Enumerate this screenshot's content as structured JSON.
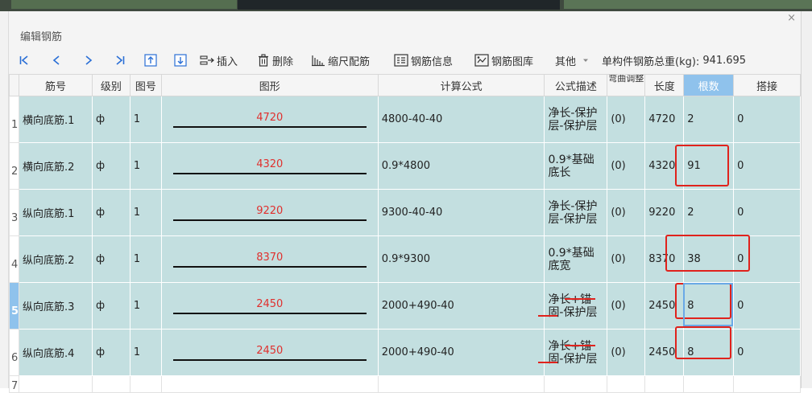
{
  "dialog": {
    "title": "编辑钢筋",
    "close_glyph": "×"
  },
  "toolbar": {
    "items": [
      {
        "icon": "first-record-icon"
      },
      {
        "icon": "prev-record-icon"
      },
      {
        "icon": "next-record-icon"
      },
      {
        "icon": "last-record-icon"
      },
      {
        "icon": "move-up-icon"
      },
      {
        "icon": "move-down-icon"
      },
      {
        "icon": "insert-icon",
        "label": "插入"
      },
      {
        "icon": "trash-icon",
        "label": "删除"
      },
      {
        "icon": "scale-rebar-icon",
        "label": "缩尺配筋"
      },
      {
        "icon": "rebar-info-icon",
        "label": "钢筋信息"
      },
      {
        "icon": "rebar-library-icon",
        "label": "钢筋图库"
      },
      {
        "icon": "chevron-down-icon",
        "label": "其他"
      }
    ],
    "total_label": "单构件钢筋总重(kg):",
    "total_value": "941.695"
  },
  "table": {
    "headers": [
      "筋号",
      "级别",
      "图号",
      "图形",
      "计算公式",
      "公式描述",
      "弯曲调整",
      "长度",
      "根数",
      "搭接"
    ],
    "selected_header": "根数",
    "rows": [
      {
        "num": "1",
        "name": "横向底筋.1",
        "grade": "ф",
        "fig": "1",
        "shape": "4720",
        "formula": "4800-40-40",
        "desc": "净长-保护层-保护层",
        "bend": "(0)",
        "length": "4720",
        "count": "2",
        "lap": "0"
      },
      {
        "num": "2",
        "name": "横向底筋.2",
        "grade": "ф",
        "fig": "1",
        "shape": "4320",
        "formula": "0.9*4800",
        "desc": "0.9*基础底长",
        "bend": "(0)",
        "length": "4320",
        "count": "91",
        "lap": "0"
      },
      {
        "num": "3",
        "name": "纵向底筋.1",
        "grade": "ф",
        "fig": "1",
        "shape": "9220",
        "formula": "9300-40-40",
        "desc": "净长-保护层-保护层",
        "bend": "(0)",
        "length": "9220",
        "count": "2",
        "lap": "0"
      },
      {
        "num": "4",
        "name": "纵向底筋.2",
        "grade": "ф",
        "fig": "1",
        "shape": "8370",
        "formula": "0.9*9300",
        "desc": "0.9*基础底宽",
        "bend": "(0)",
        "length": "8370",
        "count": "38",
        "lap": "0"
      },
      {
        "num": "5",
        "name": "纵向底筋.3",
        "grade": "ф",
        "fig": "1",
        "shape": "2450",
        "formula": "2000+490-40",
        "desc": "净长+锚固-保护层",
        "bend": "(0)",
        "length": "2450",
        "count": "8",
        "lap": "0"
      },
      {
        "num": "6",
        "name": "纵向底筋.4",
        "grade": "ф",
        "fig": "1",
        "shape": "2450",
        "formula": "2000+490-40",
        "desc": "净长+锚固-保护层",
        "bend": "(0)",
        "length": "2450",
        "count": "8",
        "lap": "0"
      }
    ],
    "empty_row_num": "7",
    "selected_row": "5"
  },
  "colors": {
    "row_bg": "#c3dfe0",
    "shape_text": "#e0302e",
    "selection": "#8fc2ec",
    "highlight": "#e0221c"
  }
}
